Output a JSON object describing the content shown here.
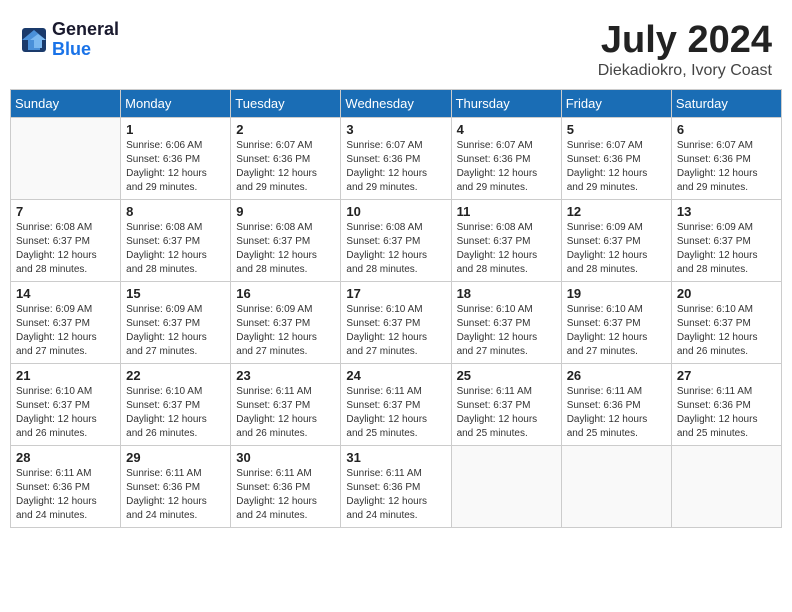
{
  "header": {
    "logo_line1": "General",
    "logo_line2": "Blue",
    "month_year": "July 2024",
    "location": "Diekadiokro, Ivory Coast"
  },
  "weekdays": [
    "Sunday",
    "Monday",
    "Tuesday",
    "Wednesday",
    "Thursday",
    "Friday",
    "Saturday"
  ],
  "weeks": [
    [
      {
        "day": "",
        "info": ""
      },
      {
        "day": "1",
        "info": "Sunrise: 6:06 AM\nSunset: 6:36 PM\nDaylight: 12 hours\nand 29 minutes."
      },
      {
        "day": "2",
        "info": "Sunrise: 6:07 AM\nSunset: 6:36 PM\nDaylight: 12 hours\nand 29 minutes."
      },
      {
        "day": "3",
        "info": "Sunrise: 6:07 AM\nSunset: 6:36 PM\nDaylight: 12 hours\nand 29 minutes."
      },
      {
        "day": "4",
        "info": "Sunrise: 6:07 AM\nSunset: 6:36 PM\nDaylight: 12 hours\nand 29 minutes."
      },
      {
        "day": "5",
        "info": "Sunrise: 6:07 AM\nSunset: 6:36 PM\nDaylight: 12 hours\nand 29 minutes."
      },
      {
        "day": "6",
        "info": "Sunrise: 6:07 AM\nSunset: 6:36 PM\nDaylight: 12 hours\nand 29 minutes."
      }
    ],
    [
      {
        "day": "7",
        "info": "Sunrise: 6:08 AM\nSunset: 6:37 PM\nDaylight: 12 hours\nand 28 minutes."
      },
      {
        "day": "8",
        "info": "Sunrise: 6:08 AM\nSunset: 6:37 PM\nDaylight: 12 hours\nand 28 minutes."
      },
      {
        "day": "9",
        "info": "Sunrise: 6:08 AM\nSunset: 6:37 PM\nDaylight: 12 hours\nand 28 minutes."
      },
      {
        "day": "10",
        "info": "Sunrise: 6:08 AM\nSunset: 6:37 PM\nDaylight: 12 hours\nand 28 minutes."
      },
      {
        "day": "11",
        "info": "Sunrise: 6:08 AM\nSunset: 6:37 PM\nDaylight: 12 hours\nand 28 minutes."
      },
      {
        "day": "12",
        "info": "Sunrise: 6:09 AM\nSunset: 6:37 PM\nDaylight: 12 hours\nand 28 minutes."
      },
      {
        "day": "13",
        "info": "Sunrise: 6:09 AM\nSunset: 6:37 PM\nDaylight: 12 hours\nand 28 minutes."
      }
    ],
    [
      {
        "day": "14",
        "info": "Sunrise: 6:09 AM\nSunset: 6:37 PM\nDaylight: 12 hours\nand 27 minutes."
      },
      {
        "day": "15",
        "info": "Sunrise: 6:09 AM\nSunset: 6:37 PM\nDaylight: 12 hours\nand 27 minutes."
      },
      {
        "day": "16",
        "info": "Sunrise: 6:09 AM\nSunset: 6:37 PM\nDaylight: 12 hours\nand 27 minutes."
      },
      {
        "day": "17",
        "info": "Sunrise: 6:10 AM\nSunset: 6:37 PM\nDaylight: 12 hours\nand 27 minutes."
      },
      {
        "day": "18",
        "info": "Sunrise: 6:10 AM\nSunset: 6:37 PM\nDaylight: 12 hours\nand 27 minutes."
      },
      {
        "day": "19",
        "info": "Sunrise: 6:10 AM\nSunset: 6:37 PM\nDaylight: 12 hours\nand 27 minutes."
      },
      {
        "day": "20",
        "info": "Sunrise: 6:10 AM\nSunset: 6:37 PM\nDaylight: 12 hours\nand 26 minutes."
      }
    ],
    [
      {
        "day": "21",
        "info": "Sunrise: 6:10 AM\nSunset: 6:37 PM\nDaylight: 12 hours\nand 26 minutes."
      },
      {
        "day": "22",
        "info": "Sunrise: 6:10 AM\nSunset: 6:37 PM\nDaylight: 12 hours\nand 26 minutes."
      },
      {
        "day": "23",
        "info": "Sunrise: 6:11 AM\nSunset: 6:37 PM\nDaylight: 12 hours\nand 26 minutes."
      },
      {
        "day": "24",
        "info": "Sunrise: 6:11 AM\nSunset: 6:37 PM\nDaylight: 12 hours\nand 25 minutes."
      },
      {
        "day": "25",
        "info": "Sunrise: 6:11 AM\nSunset: 6:37 PM\nDaylight: 12 hours\nand 25 minutes."
      },
      {
        "day": "26",
        "info": "Sunrise: 6:11 AM\nSunset: 6:36 PM\nDaylight: 12 hours\nand 25 minutes."
      },
      {
        "day": "27",
        "info": "Sunrise: 6:11 AM\nSunset: 6:36 PM\nDaylight: 12 hours\nand 25 minutes."
      }
    ],
    [
      {
        "day": "28",
        "info": "Sunrise: 6:11 AM\nSunset: 6:36 PM\nDaylight: 12 hours\nand 24 minutes."
      },
      {
        "day": "29",
        "info": "Sunrise: 6:11 AM\nSunset: 6:36 PM\nDaylight: 12 hours\nand 24 minutes."
      },
      {
        "day": "30",
        "info": "Sunrise: 6:11 AM\nSunset: 6:36 PM\nDaylight: 12 hours\nand 24 minutes."
      },
      {
        "day": "31",
        "info": "Sunrise: 6:11 AM\nSunset: 6:36 PM\nDaylight: 12 hours\nand 24 minutes."
      },
      {
        "day": "",
        "info": ""
      },
      {
        "day": "",
        "info": ""
      },
      {
        "day": "",
        "info": ""
      }
    ]
  ]
}
